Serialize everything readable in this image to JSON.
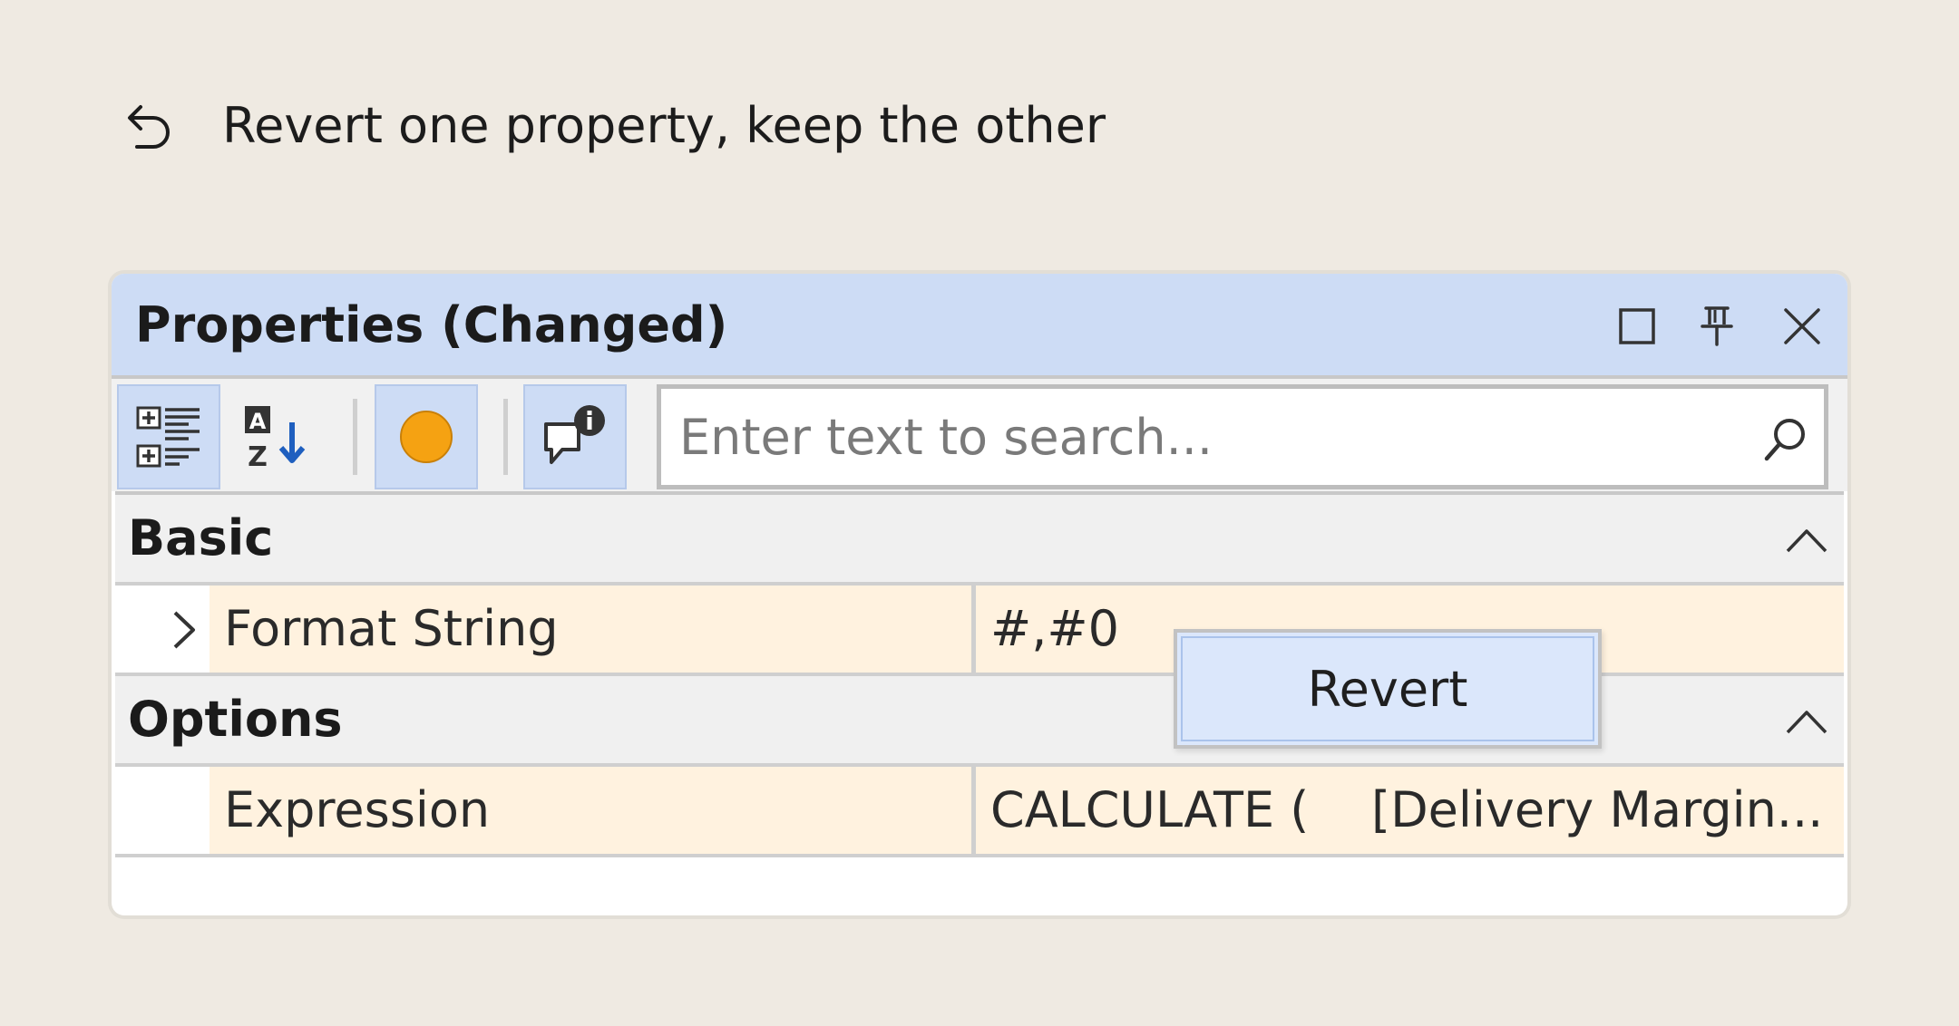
{
  "header": {
    "icon": "undo-icon",
    "title": "Revert one property, keep the other"
  },
  "panel": {
    "title": "Properties (Changed)",
    "title_buttons": [
      "maximize-icon",
      "pin-icon",
      "close-icon"
    ],
    "toolbar": {
      "buttons": [
        {
          "name": "categorized-view",
          "icon": "categorized-icon",
          "active": true
        },
        {
          "name": "alphabetical-sort",
          "icon": "sort-az-icon",
          "active": false
        },
        {
          "name": "changed-filter",
          "icon": "orange-dot-icon",
          "active": true,
          "color": "#f5a212"
        },
        {
          "name": "description",
          "icon": "comment-info-icon",
          "active": true
        }
      ],
      "search_placeholder": "Enter text to search...",
      "search_value": ""
    },
    "groups": [
      {
        "label": "Basic",
        "properties": [
          {
            "name": "Format String",
            "value": "#,#0",
            "expandable": true
          }
        ]
      },
      {
        "label": "Options",
        "properties": [
          {
            "name": "Expression",
            "value": "CALCULATE (    [Delivery Margin...",
            "expandable": false
          }
        ]
      }
    ],
    "context_menu": {
      "items": [
        "Revert"
      ]
    }
  },
  "colors": {
    "background": "#efeae2",
    "titlebar": "#cddcf5",
    "changed_row": "#fff2df",
    "accent_blue": "#1f5fbf",
    "changed_dot": "#f5a212"
  }
}
